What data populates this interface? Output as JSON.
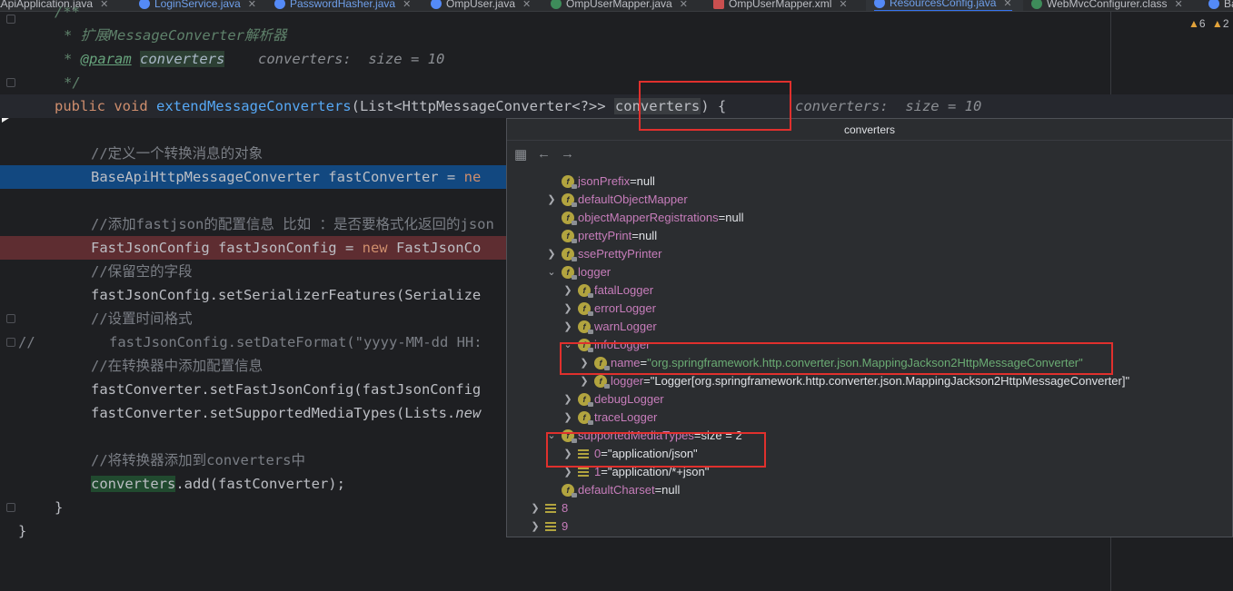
{
  "tabs": [
    {
      "label": "aApiApplication.java",
      "state": "normal",
      "icon": "java-class-icon"
    },
    {
      "label": "LoginService.java",
      "state": "changed",
      "icon": "java-class-icon"
    },
    {
      "label": "PasswordHasher.java",
      "state": "changed",
      "icon": "java-class-icon"
    },
    {
      "label": "OmpUser.java",
      "state": "normal",
      "icon": "java-class-icon"
    },
    {
      "label": "OmpUserMapper.java",
      "state": "normal",
      "icon": "java-interface-icon"
    },
    {
      "label": "OmpUserMapper.xml",
      "state": "normal",
      "icon": "xml-file-icon"
    },
    {
      "label": "ResourcesConfig.java",
      "state": "active",
      "icon": "java-class-icon"
    },
    {
      "label": "WebMvcConfigurer.class",
      "state": "normal",
      "icon": "class-file-icon"
    },
    {
      "label": "Ba",
      "state": "normal",
      "icon": "java-class-icon"
    }
  ],
  "inspections": {
    "warnings": "6",
    "other": "2"
  },
  "code": {
    "l1": "/**",
    "l2_star": "* ",
    "l2_text": "扩展MessageConverter解析器",
    "l3_star": "* ",
    "l3_tag": "@param",
    "l3_param": "converters",
    "l3_inlay": "converters:  size = 10",
    "l4": "*/",
    "l5_mod": "public void ",
    "l5_fn": "extendMessageConverters",
    "l5_a": "(List<HttpMessageConverter<?>> ",
    "l5_param": "converters",
    "l5_b": ") {",
    "l5_inlay": "converters:  size = 10",
    "l7": "//定义一个转换消息的对象",
    "l8_a": "BaseApiHttpMessageConverter fastConverter = ",
    "l8_kw": "ne",
    "l10": "//添加fastjson的配置信息 比如 ：是否要格式化返回的json",
    "l11_a": "FastJsonConfig fastJsonConfig = ",
    "l11_kw": "new ",
    "l11_b": "FastJsonCo",
    "l12": "//保留空的字段",
    "l13": "fastJsonConfig.setSerializerFeatures(Serialize",
    "l14": "//设置时间格式",
    "l15_cm": "//",
    "l15": "fastJsonConfig.setDateFormat(\"yyyy-MM-dd HH:",
    "l16": "//在转换器中添加配置信息",
    "l17": "fastConverter.setFastJsonConfig(fastJsonConfig",
    "l18_a": "fastConverter.setSupportedMediaTypes(Lists.",
    "l18_b": "new",
    "l20": "//将转换器添加到converters中",
    "l21_hl": "converters",
    "l21_b": ".add(fastConverter);",
    "l22": "}",
    "l23": "}"
  },
  "popup": {
    "title": "converters",
    "rows": [
      {
        "name": "jsonPrefix",
        "value": "null",
        "kind": "field"
      },
      {
        "name": "defaultObjectMapper",
        "value": "",
        "kind": "field"
      },
      {
        "name": "objectMapperRegistrations",
        "value": "null",
        "kind": "field"
      },
      {
        "name": "prettyPrint",
        "value": "null",
        "kind": "field"
      },
      {
        "name": "ssePrettyPrinter",
        "value": "",
        "kind": "field"
      },
      {
        "name": "logger",
        "value": "",
        "kind": "field"
      },
      {
        "name": "fatalLogger",
        "value": "",
        "kind": "field"
      },
      {
        "name": "errorLogger",
        "value": "",
        "kind": "field"
      },
      {
        "name": "warnLogger",
        "value": "",
        "kind": "field"
      },
      {
        "name": "infoLogger",
        "value": "",
        "kind": "field"
      },
      {
        "name": "name",
        "value": "\"org.springframework.http.converter.json.MappingJackson2HttpMessageConverter\"",
        "kind": "field"
      },
      {
        "name": "logger",
        "value": "\"Logger[org.springframework.http.converter.json.MappingJackson2HttpMessageConverter]\"",
        "kind": "field"
      },
      {
        "name": "debugLogger",
        "value": "",
        "kind": "field"
      },
      {
        "name": "traceLogger",
        "value": "",
        "kind": "field"
      },
      {
        "name": "supportedMediaTypes",
        "value": "size = 2",
        "kind": "field"
      },
      {
        "name": "0",
        "value": "\"application/json\"",
        "kind": "index"
      },
      {
        "name": "1",
        "value": "\"application/*+json\"",
        "kind": "index"
      },
      {
        "name": "defaultCharset",
        "value": "null",
        "kind": "field"
      },
      {
        "name": "8",
        "value": "",
        "kind": "index"
      },
      {
        "name": "9",
        "value": "",
        "kind": "index"
      }
    ]
  },
  "colors": {
    "annotation": "#e0302d",
    "editor_bg": "#1e1f22",
    "exec_line": "#124880",
    "breakpoint_line": "#5e2d31"
  }
}
